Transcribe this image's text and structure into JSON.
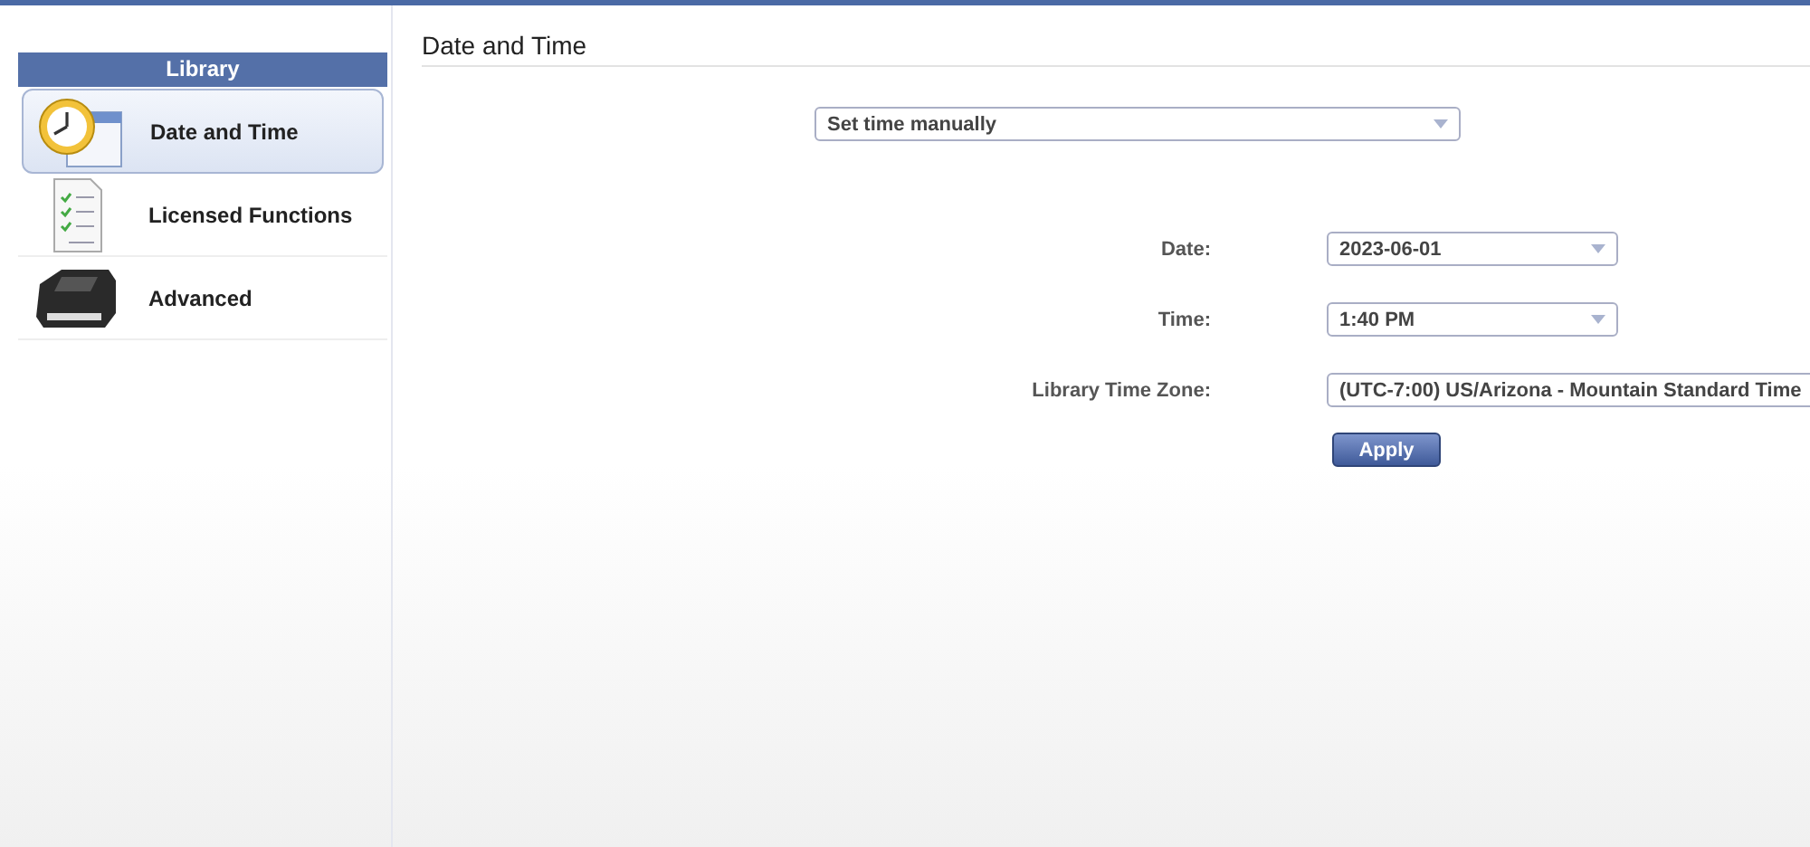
{
  "sidebar": {
    "header": "Library",
    "items": [
      {
        "label": "Date and Time",
        "kind": "clock",
        "selected": true
      },
      {
        "label": "Licensed Functions",
        "kind": "document",
        "selected": false
      },
      {
        "label": "Advanced",
        "kind": "drive",
        "selected": false
      }
    ]
  },
  "main": {
    "title": "Date and Time",
    "mode": "Set time manually",
    "fields": [
      {
        "label": "Date:",
        "value": "2023-06-01"
      },
      {
        "label": "Time:",
        "value": "1:40 PM"
      },
      {
        "label": "Library Time Zone:",
        "value": "(UTC-7:00) US/Arizona - Mountain Standard Time"
      }
    ],
    "apply": "Apply"
  }
}
